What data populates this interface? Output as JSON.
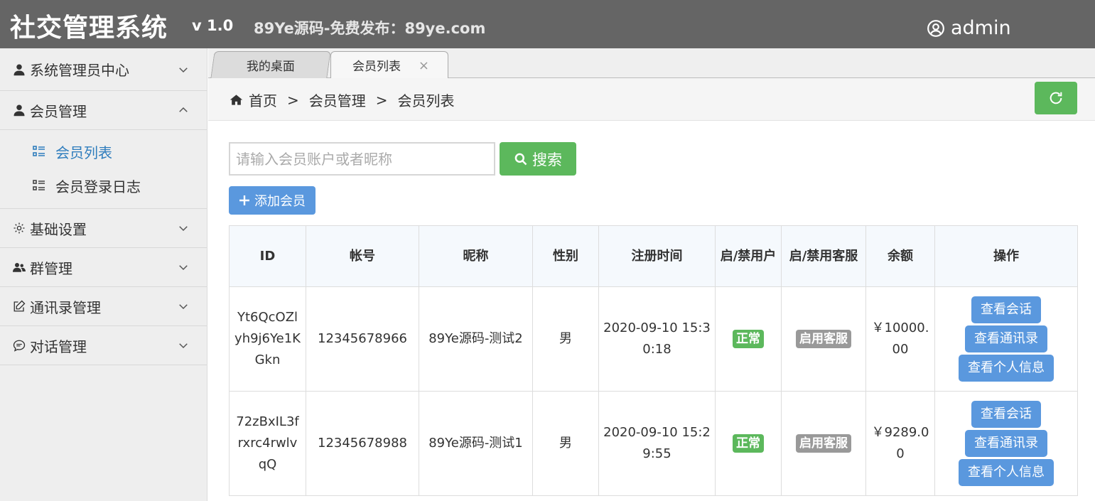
{
  "header": {
    "title": "社交管理系统",
    "version": "v 1.0",
    "slogan": "89Ye源码-免费发布：89ye.com",
    "user": "admin",
    "user_icon": "user-circle-icon"
  },
  "sidebar": {
    "groups": [
      {
        "label": "系统管理员中心",
        "icon": "person-icon",
        "expanded": false
      },
      {
        "label": "会员管理",
        "icon": "person-icon",
        "expanded": true,
        "items": [
          {
            "label": "会员列表",
            "active": true
          },
          {
            "label": "会员登录日志",
            "active": false
          }
        ]
      },
      {
        "label": "基础设置",
        "icon": "gear-icon",
        "expanded": false
      },
      {
        "label": "群管理",
        "icon": "group-icon",
        "expanded": false
      },
      {
        "label": "通讯录管理",
        "icon": "edit-icon",
        "expanded": false
      },
      {
        "label": "对话管理",
        "icon": "chat-icon",
        "expanded": false
      }
    ]
  },
  "tabs": [
    {
      "label": "我的桌面",
      "active": false
    },
    {
      "label": "会员列表",
      "active": true,
      "close": "×"
    }
  ],
  "breadcrumb": {
    "items": [
      "首页",
      "会员管理",
      "会员列表"
    ],
    "separator": ">"
  },
  "search": {
    "placeholder": "请输入会员账户或者昵称",
    "value": "",
    "button": "搜索"
  },
  "add_button": "添加会员",
  "table": {
    "columns": [
      "ID",
      "帐号",
      "昵称",
      "性别",
      "注册时间",
      "启/禁用户",
      "启/禁用客服",
      "余额",
      "操作"
    ],
    "rows": [
      {
        "id": "Yt6QcOZlyh9j6Ye1KGkn",
        "account": "12345678966",
        "nickname": "89Ye源码-测试2",
        "gender": "男",
        "registered": "2020-09-10 15:30:18",
        "user_status": "正常",
        "cs_status": "启用客服",
        "balance": "￥10000.00",
        "actions": [
          "查看会话",
          "查看通讯录",
          "查看个人信息"
        ]
      },
      {
        "id": "72zBxIL3frxrc4rwlvqQ",
        "account": "12345678988",
        "nickname": "89Ye源码-测试1",
        "gender": "男",
        "registered": "2020-09-10 15:29:55",
        "user_status": "正常",
        "cs_status": "启用客服",
        "balance": "￥9289.00",
        "actions": [
          "查看会话",
          "查看通讯录",
          "查看个人信息"
        ]
      }
    ]
  },
  "colors": {
    "header_bg": "#656565",
    "sidebar_bg": "#eeeeee",
    "active_link": "#2f7dbd",
    "green": "#5cb85c",
    "blue": "#5a98de",
    "gray_badge": "#999999"
  }
}
